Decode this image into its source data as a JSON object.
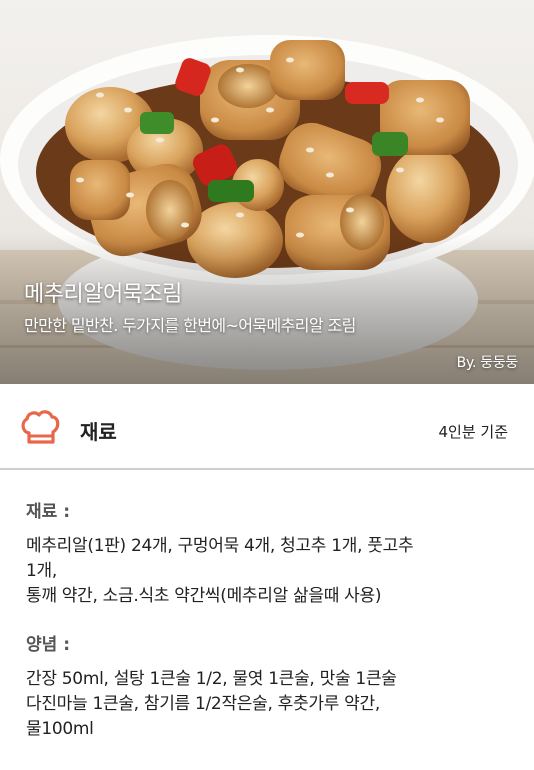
{
  "hero": {
    "title": "메추리알어묵조림",
    "subtitle": "만만한 밑반찬. 두가지를 한번에~어묵메추리알 조림",
    "author": "By.  둥둥둥"
  },
  "section": {
    "icon": "chef-hat-icon",
    "title": "재료",
    "serving": "4인분 기준"
  },
  "ingredients": {
    "main_label": "재료 :",
    "main_lines": [
      "메추리알(1판) 24개, 구멍어묵 4개, 청고추 1개, 풋고추",
      "1개,",
      "통깨 약간, 소금.식초 약간씩(메추리알 삶을때 사용)"
    ],
    "sauce_label": "양념 :",
    "sauce_lines": [
      "간장 50ml, 설탕 1큰술 1/2, 물엿 1큰술, 맛술 1큰술",
      "다진마늘 1큰술, 참기름 1/2작은술, 후춧가루 약간,",
      "물100ml"
    ]
  },
  "colors": {
    "accent": "#e8674a",
    "divider": "#cfcfcf"
  }
}
